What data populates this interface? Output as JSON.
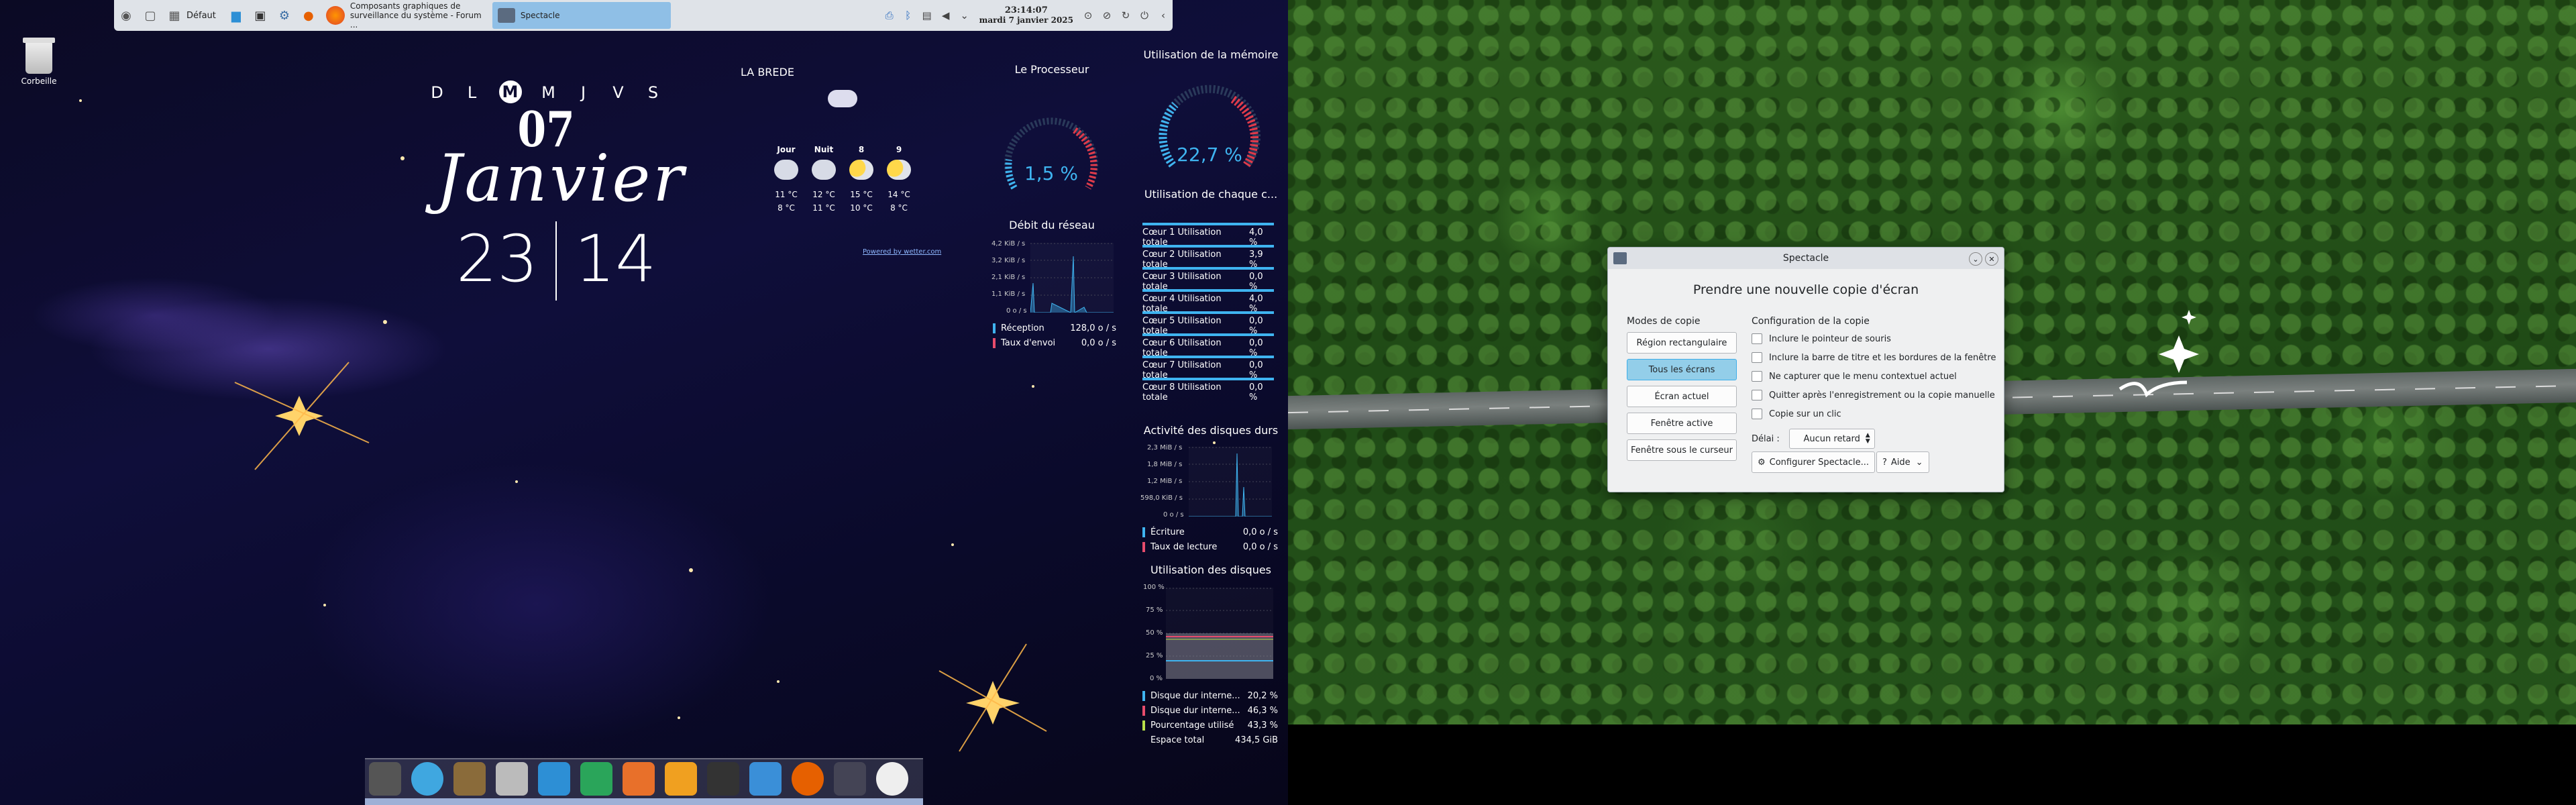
{
  "panel": {
    "activity_label": "Défaut",
    "tasks": [
      {
        "label": "Composants graphiques de\nsurveillance du système - Forum ..."
      },
      {
        "label": "Spectacle"
      }
    ],
    "clock_time": "23:14:07",
    "clock_date": "mardi 7 janvier 2025"
  },
  "desktop": {
    "trash_label": "Corbeille"
  },
  "date_widget": {
    "weekdays": [
      "D",
      "L",
      "M",
      "M",
      "J",
      "V",
      "S"
    ],
    "today_index": 2,
    "day": "07",
    "month": "Janvier",
    "hour": "23",
    "minute": "14"
  },
  "weather": {
    "location": "LA BREDE",
    "columns": [
      {
        "head": "Jour",
        "hi": "11 °C",
        "lo": "8 °C",
        "icon": "cloud-rain-icon"
      },
      {
        "head": "Nuit",
        "hi": "12 °C",
        "lo": "11 °C",
        "icon": "cloud-rain-icon"
      },
      {
        "head": "8",
        "hi": "15 °C",
        "lo": "10 °C",
        "icon": "sun-cloud-icon"
      },
      {
        "head": "9",
        "hi": "14 °C",
        "lo": "8 °C",
        "icon": "sun-cloud-icon"
      }
    ],
    "powered": "Powered by wetter.com"
  },
  "monitors": {
    "cpu": {
      "title": "Le Processeur",
      "value": "1,5 %",
      "fraction": 0.015
    },
    "memory": {
      "title": "Utilisation de la mémoire",
      "value": "22,7 %",
      "fraction": 0.227
    },
    "network": {
      "title": "Débit du réseau",
      "ticks": [
        "4,2 KiB / s",
        "3,2 KiB / s",
        "2,1 KiB / s",
        "1,1 KiB / s",
        "0 o / s"
      ],
      "rx_label": "Réception",
      "rx_value": "128,0 o / s",
      "tx_label": "Taux d'envoi",
      "tx_value": "0,0 o / s"
    },
    "cores": {
      "title": "Utilisation de chaque c...",
      "rows": [
        {
          "label": "Cœur 1 Utilisation totale",
          "value": "4,0 %"
        },
        {
          "label": "Cœur 2 Utilisation totale",
          "value": "3,9 %"
        },
        {
          "label": "Cœur 3 Utilisation totale",
          "value": "0,0 %"
        },
        {
          "label": "Cœur 4 Utilisation totale",
          "value": "4,0 %"
        },
        {
          "label": "Cœur 5 Utilisation totale",
          "value": "0,0 %"
        },
        {
          "label": "Cœur 6 Utilisation totale",
          "value": "0,0 %"
        },
        {
          "label": "Cœur 7 Utilisation totale",
          "value": "0,0 %"
        },
        {
          "label": "Cœur 8 Utilisation totale",
          "value": "0,0 %"
        }
      ]
    },
    "disk_activity": {
      "title": "Activité des disques durs",
      "ticks": [
        "2,3 MiB / s",
        "1,8 MiB / s",
        "1,2 MiB / s",
        "598,0 KiB / s",
        "0 o / s"
      ],
      "write_label": "Écriture",
      "write_value": "0,0 o / s",
      "read_label": "Taux de lecture",
      "read_value": "0,0 o / s"
    },
    "disk_usage": {
      "title": "Utilisation des disques",
      "ticks": [
        "100 %",
        "75 %",
        "50 %",
        "25 %",
        "0 %"
      ],
      "rows": [
        {
          "label": "Disque dur interne...",
          "value": "20,2 %",
          "color": "#3fb4f0"
        },
        {
          "label": "Disque dur interne...",
          "value": "46,3 %",
          "color": "#e74c6c"
        },
        {
          "label": "Pourcentage utilisé",
          "value": "43,3 %",
          "color": "#b8e04a"
        },
        {
          "label": "Espace total",
          "value": "434,5 GiB",
          "color": ""
        }
      ]
    }
  },
  "dock": {
    "icons": [
      "calculator-icon",
      "globe-icon",
      "gimp-icon",
      "phone-icon",
      "document-icon",
      "spreadsheet-icon",
      "presentation-icon",
      "archive-icon",
      "terminal-icon",
      "folder-icon",
      "firefox-icon",
      "monitor-icon",
      "clock-icon"
    ]
  },
  "spectacle": {
    "window_title": "Spectacle",
    "heading": "Prendre une nouvelle copie d'écran",
    "modes_title": "Modes de copie",
    "modes": [
      "Région rectangulaire",
      "Tous les écrans",
      "Écran actuel",
      "Fenêtre active",
      "Fenêtre sous le curseur"
    ],
    "selected_mode": 1,
    "config_title": "Configuration de la copie",
    "options": [
      "Inclure le pointeur de souris",
      "Inclure la barre de titre et les bordures de la fenêtre",
      "Ne capturer que le menu contextuel actuel",
      "Quitter après l'enregistrement ou la copie manuelle",
      "Copie sur un clic"
    ],
    "delay_label": "Délai :",
    "delay_value": "Aucun retard",
    "configure_label": "Configurer Spectacle...",
    "help_label": "Aide"
  },
  "colors": {
    "accent": "#3fb4f0",
    "selected_mode_bg": "#93cee9",
    "panel_bg": "#dfe3e8"
  }
}
